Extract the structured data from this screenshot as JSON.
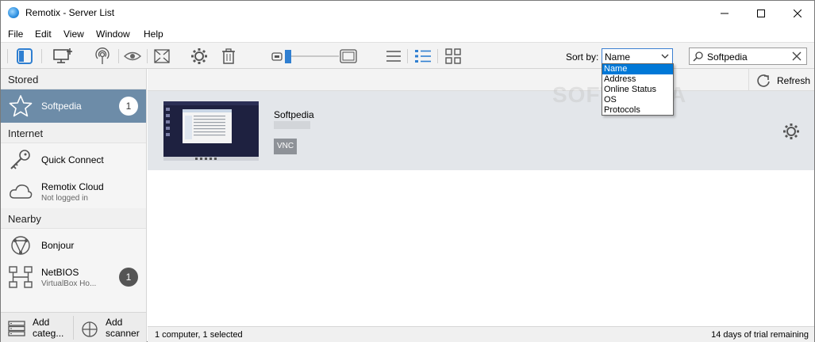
{
  "window": {
    "title": "Remotix - Server List"
  },
  "menu": [
    "File",
    "Edit",
    "View",
    "Window",
    "Help"
  ],
  "toolbar": {
    "sort_label": "Sort by:",
    "sort_value": "Name",
    "sort_options": [
      "Name",
      "Address",
      "Online Status",
      "OS",
      "Protocols"
    ],
    "search_value": "Softpedia"
  },
  "sidebar": {
    "stored_header": "Stored",
    "stored_item": {
      "label": "Softpedia",
      "badge": "1"
    },
    "internet_header": "Internet",
    "quick_connect": "Quick Connect",
    "cloud": {
      "label": "Remotix Cloud",
      "sub": "Not logged in"
    },
    "nearby_header": "Nearby",
    "bonjour": "Bonjour",
    "netbios": {
      "label": "NetBIOS",
      "sub": "VirtualBox Ho...",
      "badge": "1"
    },
    "footer": {
      "add_category_1": "Add",
      "add_category_2": "categ...",
      "add_scanner_1": "Add",
      "add_scanner_2": "scanner"
    }
  },
  "main": {
    "refresh_label": "Refresh",
    "server": {
      "name": "Softpedia",
      "protocol": "VNC"
    }
  },
  "status": {
    "left": "1 computer, 1 selected",
    "right": "14 days of trial remaining"
  },
  "watermark": "SOFTPEDIA",
  "colors": {
    "accent": "#0078d7",
    "selected_sidebar": "#6d8ca8",
    "toolbar_blue": "#2f7fd1"
  }
}
